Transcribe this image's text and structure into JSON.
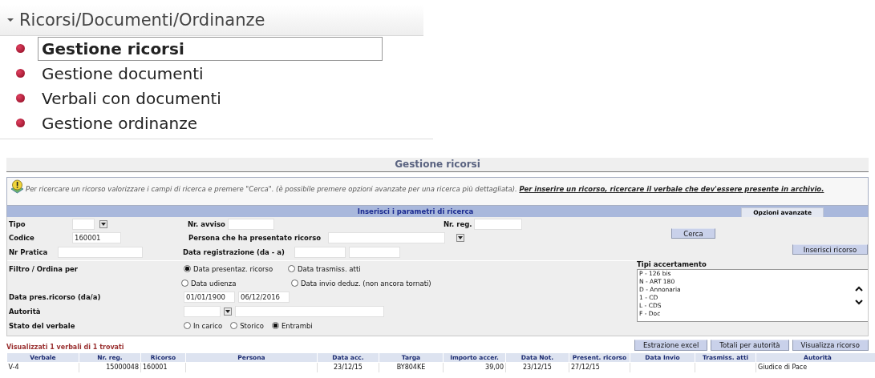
{
  "menu": {
    "title": "Ricorsi/Documenti/Ordinanze",
    "expanded": true,
    "items": [
      {
        "label": "Gestione ricorsi",
        "selected": true
      },
      {
        "label": "Gestione documenti",
        "selected": false
      },
      {
        "label": "Verbali con documenti",
        "selected": false
      },
      {
        "label": "Gestione ordinanze",
        "selected": false
      }
    ]
  },
  "page": {
    "title": "Gestione ricorsi",
    "info": {
      "text": "Per ricercare un ricorso valorizzare i campi di ricerca e premere \"Cerca\". (è possibile premere opzioni avanzate per una ricerca più dettagliata).",
      "link": "Per inserire un ricorso, ricercare il verbale che dev'essere presente in archivio."
    },
    "search": {
      "header": "Inserisci i parametri di ricerca",
      "advanced_tab": "Opzioni avanzate",
      "tipo": {
        "label": "Tipo"
      },
      "nr_avviso": {
        "label": "Nr. avviso"
      },
      "nr_reg": {
        "label": "Nr. reg."
      },
      "codice": {
        "label": "Codice",
        "value": "160001"
      },
      "persona": {
        "label": "Persona che ha presentato ricorso"
      },
      "nr_pratica": {
        "label": "Nr Pratica"
      },
      "data_registrazione": {
        "label": "Data registrazione (da - a)"
      },
      "filtro": {
        "label": "Filtro / Ordina per",
        "options": [
          {
            "label": "Data presentaz. ricorso",
            "selected": true
          },
          {
            "label": "Data trasmiss. atti",
            "selected": false
          },
          {
            "label": "Data udienza",
            "selected": false
          },
          {
            "label": "Data invio deduz. (non ancora tornati)",
            "selected": false
          }
        ]
      },
      "data_pres": {
        "label": "Data pres.ricorso (da/a)",
        "from": "01/01/1900",
        "to": "06/12/2016"
      },
      "autorita": {
        "label": "Autorità"
      },
      "stato": {
        "label": "Stato del verbale",
        "options": [
          {
            "label": "In carico",
            "selected": false
          },
          {
            "label": "Storico",
            "selected": false
          },
          {
            "label": "Entrambi",
            "selected": true
          }
        ]
      },
      "buttons": [
        "Cerca",
        "Inserisci ricorso"
      ],
      "tipi_accertamento": {
        "label": "Tipi accertamento",
        "items": [
          "P - 126 bis",
          "N - ART 180",
          "D - Annonaria",
          "1 - CD",
          "L - CDS",
          "F - Doc"
        ]
      }
    },
    "results": {
      "summary": "Visualizzati 1 verbali di 1 trovati",
      "buttons": [
        "Estrazione excel",
        "Totali per autorità",
        "Visualizza ricorso"
      ],
      "table": {
        "columns": [
          "Verbale",
          "Nr. reg.",
          "Ricorso",
          "Persona",
          "Data acc.",
          "Targa",
          "Importo accer.",
          "Data Not.",
          "Present. ricorso",
          "Data Invio",
          "Trasmiss. atti",
          "Autorità"
        ],
        "rows": [
          [
            "V-4",
            "15000048",
            "160001",
            "",
            "23/12/15",
            "BY804KE",
            "39,00",
            "23/12/15",
            "27/12/15",
            "",
            "",
            "Giudice di Pace"
          ]
        ]
      }
    }
  }
}
